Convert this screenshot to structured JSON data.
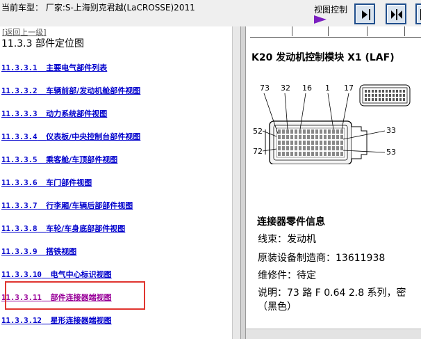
{
  "header": {
    "vehicle_info": "当前车型：  厂家:S-上海别克君越(LaCROSSE)2011",
    "view_control_label": "视图控制"
  },
  "left_pane": {
    "back_link": "[返回上一级]",
    "section_title": "11.3.3 部件定位图",
    "items": [
      {
        "number": "11.3.3.1",
        "title": "主要电气部件列表"
      },
      {
        "number": "11.3.3.2",
        "title": "车辆前部/发动机舱部件视图"
      },
      {
        "number": "11.3.3.3",
        "title": "动力系统部件视图"
      },
      {
        "number": "11.3.3.4",
        "title": "仪表板/中央控制台部件视图"
      },
      {
        "number": "11.3.3.5",
        "title": "乘客舱/车顶部件视图"
      },
      {
        "number": "11.3.3.6",
        "title": "车门部件视图"
      },
      {
        "number": "11.3.3.7",
        "title": "行李厢/车辆后部部件视图"
      },
      {
        "number": "11.3.3.8",
        "title": "车轮/车身底部部件视图"
      },
      {
        "number": "11.3.3.9",
        "title": "搭铁视图"
      },
      {
        "number": "11.3.3.10",
        "title": "电气中心标识视图"
      },
      {
        "number": "11.3.3.11",
        "title": "部件连接器端视图"
      },
      {
        "number": "11.3.3.12",
        "title": "星形连接器端视图"
      }
    ],
    "highlight_color": "#e0352f",
    "link_color": "#0000cc"
  },
  "right_pane": {
    "module_title": "K20 发动机控制模块  X1 (LAF)",
    "pin_labels": {
      "top": [
        "73",
        "32",
        "16",
        "1",
        "17"
      ],
      "left": [
        "52",
        "72"
      ],
      "right": [
        "33",
        "53"
      ]
    },
    "parts_info_title": "连接器零件信息",
    "info_lines": [
      "线束：发动机",
      "原装设备制造商：13611938",
      "维修件：待定",
      "说明：73 路 F 0.64 2.8 系列，密",
      "（黑色）"
    ]
  }
}
